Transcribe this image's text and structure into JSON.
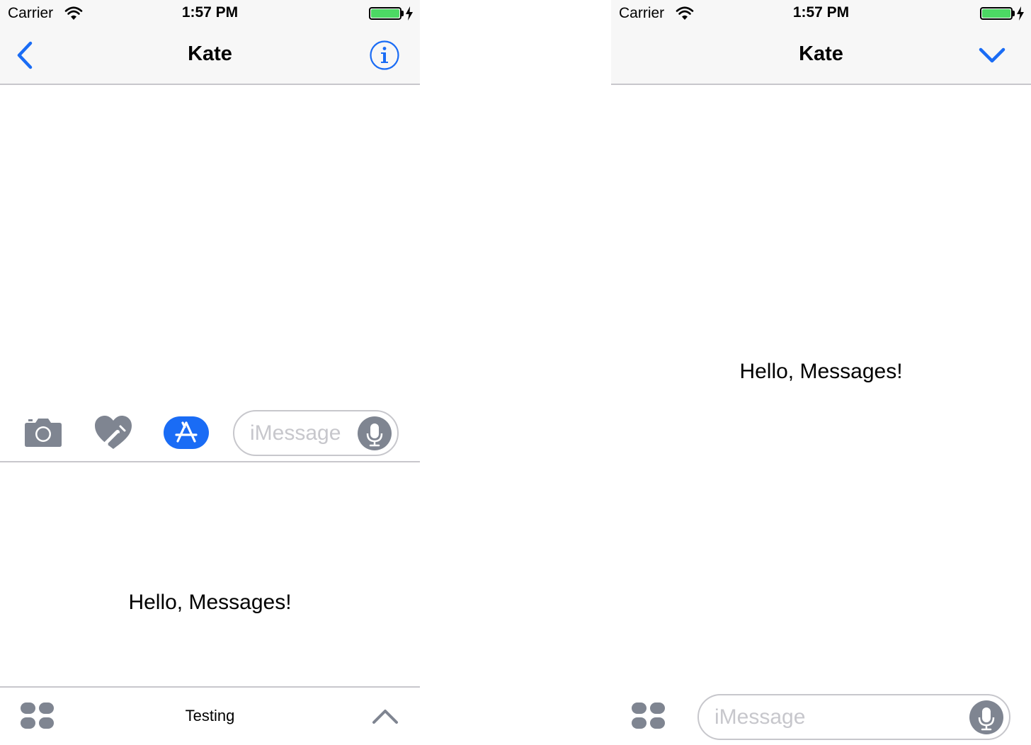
{
  "left_screen": {
    "status_bar": {
      "carrier": "Carrier",
      "time": "1:57 PM",
      "battery_color": "#4cd964"
    },
    "nav": {
      "title": "Kate",
      "back_icon": "chevron-left-icon",
      "info_icon": "info-icon"
    },
    "toolbar": {
      "icons": [
        "camera-icon",
        "digital-touch-heart-icon",
        "app-store-icon"
      ],
      "input_placeholder": "iMessage",
      "input_value": "",
      "mic_icon": "microphone-icon"
    },
    "extension": {
      "message": "Hello, Messages!",
      "drawer_label": "Testing",
      "apps_icon": "app-drawer-icon",
      "expand_icon": "chevron-up-icon"
    }
  },
  "right_screen": {
    "status_bar": {
      "carrier": "Carrier",
      "time": "1:57 PM",
      "battery_color": "#4cd964"
    },
    "nav": {
      "title": "Kate",
      "collapse_icon": "chevron-down-icon"
    },
    "extension": {
      "message": "Hello, Messages!"
    },
    "toolbar": {
      "apps_icon": "app-drawer-icon",
      "input_placeholder": "iMessage",
      "input_value": "",
      "mic_icon": "microphone-icon"
    }
  },
  "colors": {
    "accent": "#1a6cf5",
    "icon_gray": "#7f8591",
    "bar_bg": "#f7f7f7",
    "separator": "#c8c7cc"
  }
}
